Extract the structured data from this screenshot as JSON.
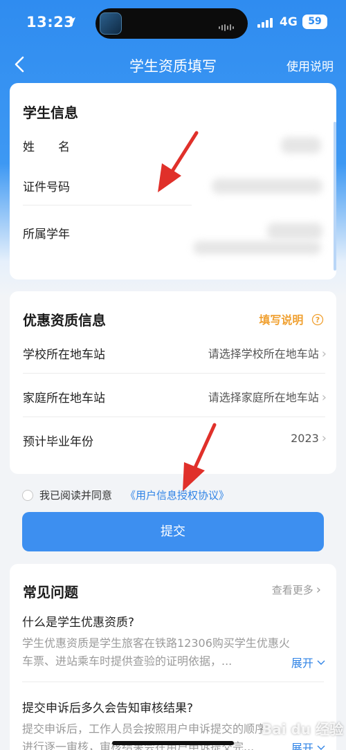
{
  "status_bar": {
    "time": "13:23",
    "network": "4G",
    "battery": "59"
  },
  "nav": {
    "title": "学生资质填写",
    "right_label": "使用说明"
  },
  "student_info": {
    "title": "学生信息",
    "rows": [
      {
        "label": "姓　　名"
      },
      {
        "label": "证件号码"
      },
      {
        "label": "所属学年"
      }
    ]
  },
  "discount_info": {
    "title": "优惠资质信息",
    "help_label": "填写说明",
    "rows": [
      {
        "label": "学校所在地车站",
        "value": "请选择学校所在地车站"
      },
      {
        "label": "家庭所在地车站",
        "value": "请选择家庭所在地车站"
      },
      {
        "label": "预计毕业年份",
        "value": "2023"
      }
    ]
  },
  "agreement": {
    "text": "我已阅读并同意",
    "link": "《用户信息授权协议》"
  },
  "submit_label": "提交",
  "faq": {
    "title": "常见问题",
    "more_label": "查看更多",
    "items": [
      {
        "question": "什么是学生优惠资质?",
        "answer_line1": "学生优惠资质是学生旅客在铁路12306购买学生优惠火",
        "answer_line2": "车票、进站乘车时提供查验的证明依据，...",
        "expand": "展开"
      },
      {
        "question": "提交申诉后多久会告知审核结果?",
        "answer_line1": "提交申诉后，工作人员会按照用户申诉提交的顺序",
        "answer_line2": "进行逐一审核，审核结果会在用户申诉提交完...",
        "expand": "展开"
      }
    ]
  },
  "watermark": "Bai du 经验",
  "colors": {
    "primary": "#3d8ff0",
    "accent_orange": "#f0a030",
    "link": "#2f83e6",
    "arrow": "#e0302a"
  }
}
